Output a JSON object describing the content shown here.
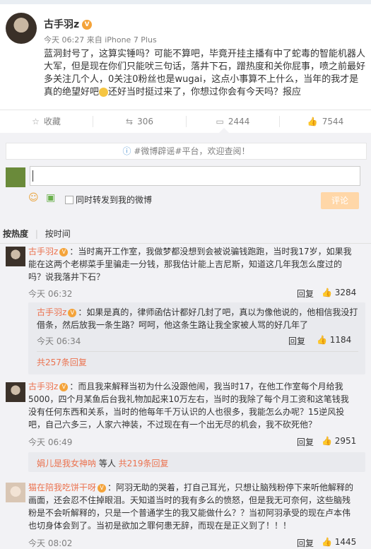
{
  "post": {
    "author": "古手羽z",
    "meta": "今天 06:27 来自 iPhone 7 Plus",
    "text_a": "蓝洞封号了，这算实锤吗？可能不算吧，毕竟开挂主播有中了蛇毒的智能机器人大军，但是现在你们只能吠三句话，落井下石，蹭热度和关你屁事，喷之前最好多关注几个人，0关注0粉丝也是wugai，这点小事算不上什么，当年的我才是真的绝望好吧",
    "text_b": "还好当时挺过来了，你想过你会有今天吗？报应"
  },
  "actions": {
    "favorite": "收藏",
    "repost": "306",
    "comment": "2444",
    "like": "7544"
  },
  "notice": "#微博辟谣#平台，欢迎查阅！",
  "composer": {
    "forward_label": "同时转发到我的微博",
    "submit": "评论"
  },
  "sort": {
    "hot": "按热度",
    "time": "按时间"
  },
  "comments": [
    {
      "author": "古手羽z",
      "text": "：当时离开工作室，我做梦都没想到会被说骗钱跑跑，当时我17岁，如果我能在这两个老梆菜手里骗走一分钱，那我估计能上吉尼斯，知道这几年我怎么度过的吗？说我落井下石？",
      "time": "今天 06:32",
      "reply": "回复",
      "likes": "3284",
      "sub": {
        "author": "古手羽z",
        "text": "：如果是真的，律师函估计都好几封了吧，真以为像他说的，他相信我没打借条，然后放我一条生路？呵呵，他这条生路让我全家被人骂的好几年了",
        "time": "今天 06:34",
        "reply": "回复",
        "likes": "1184"
      },
      "more": "共257条回复"
    },
    {
      "author": "古手羽z",
      "text": "：而且我来解释当初为什么没跟他闹，我当时17，在他工作室每个月给我5000，四个月某鱼后台我礼物加起来10万左右，当时的我除了每个月工资和这笔钱我没有任何东西和关系，当时的他每年千万认识的人也很多，我能怎么办呢？15逆风投吧，自己六多三，人家六神装，不过现在有一个出无尽的机会，我不砍死他？",
      "time": "今天 06:49",
      "reply": "回复",
      "likes": "2951",
      "more_prefix": "娟儿是我女神呐",
      "more_mid": " 等人 ",
      "more_link": "共219条回复"
    },
    {
      "author": "猫在陪我吃饼干呀",
      "text": "：阿羽无助的哭着，打自己耳光，只想让脑残粉停下来听他解释的画面，还会忍不住掉眼泪。天知道当时的我有多么的愤怒，但是我无可奈何，这些脑残粉是不会听解释的，只是一个普通学生的我又能做什么？？当初阿羽承受的现在卢本伟也切身体会到了。当初是欲加之罪何患无辞，而现在是正义到了！！！",
      "time": "今天 08:02",
      "reply": "回复",
      "likes": "1445"
    }
  ]
}
